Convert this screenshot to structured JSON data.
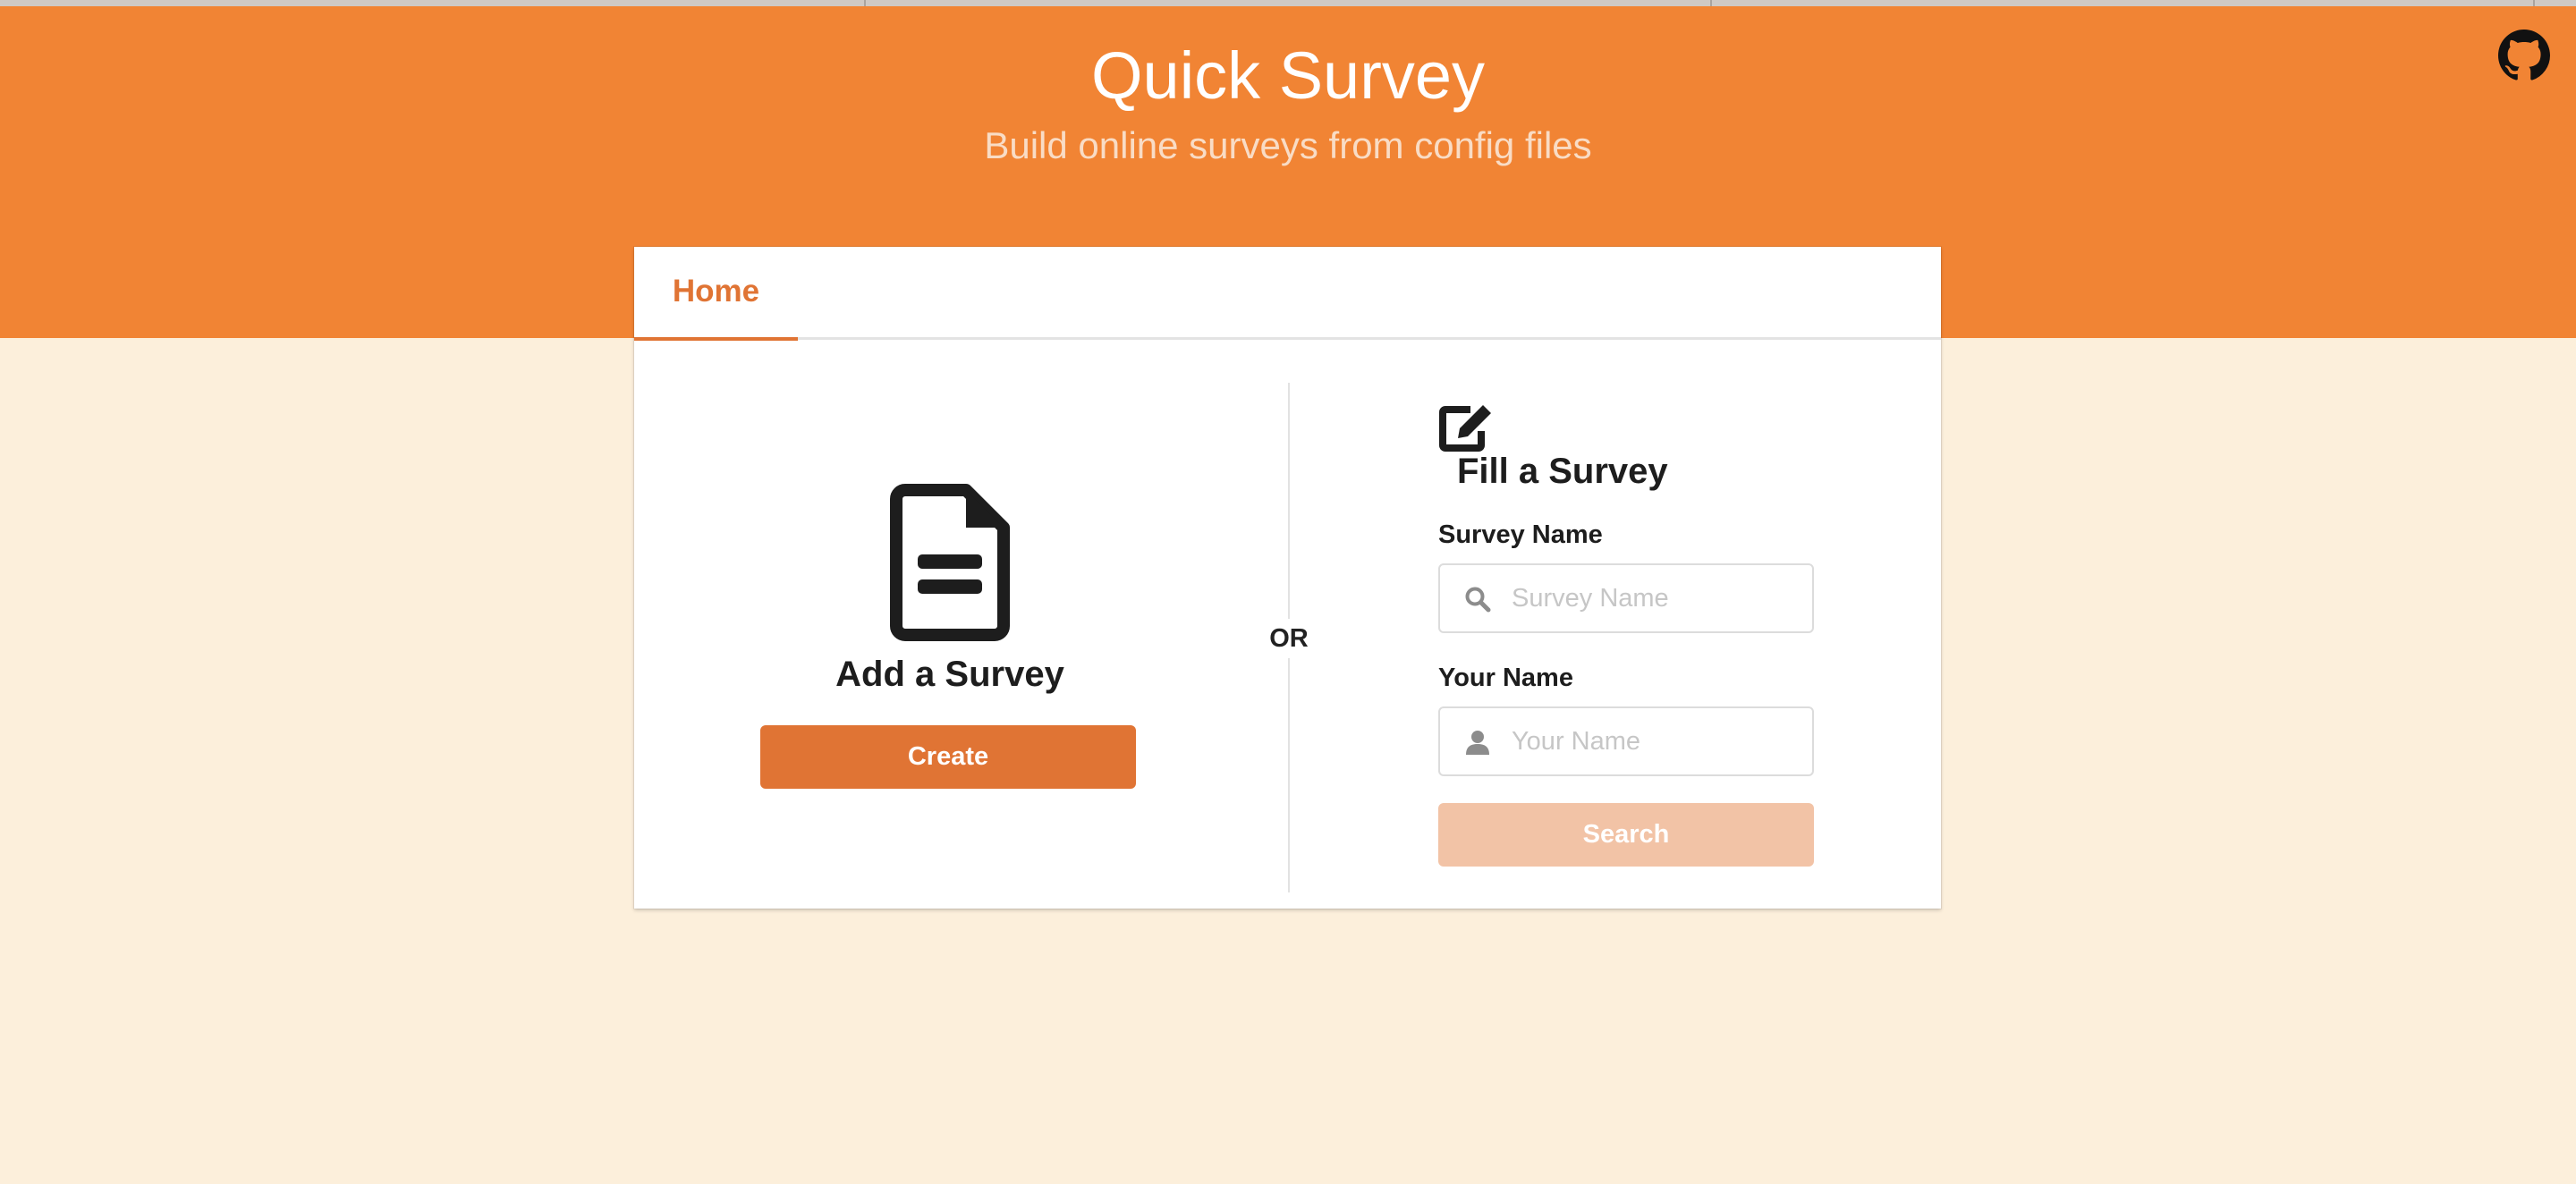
{
  "header": {
    "title": "Quick Survey",
    "subtitle": "Build online surveys from config files",
    "github_icon": "github-icon"
  },
  "tabs": [
    {
      "label": "Home",
      "active": true
    }
  ],
  "add_survey": {
    "icon": "document-icon",
    "title": "Add a Survey",
    "button_label": "Create"
  },
  "separator": {
    "label": "OR"
  },
  "fill_survey": {
    "icon": "edit-icon",
    "title": "Fill a Survey",
    "survey_name": {
      "label": "Survey Name",
      "placeholder": "Survey Name",
      "value": "",
      "icon": "search-icon"
    },
    "your_name": {
      "label": "Your Name",
      "placeholder": "Your Name",
      "value": "",
      "icon": "user-icon"
    },
    "button_label": "Search",
    "button_disabled": true
  },
  "colors": {
    "header_bg": "#f18434",
    "page_bg": "#fcefdb",
    "accent": "#e07434",
    "disabled_button": "#f2c3a6"
  }
}
